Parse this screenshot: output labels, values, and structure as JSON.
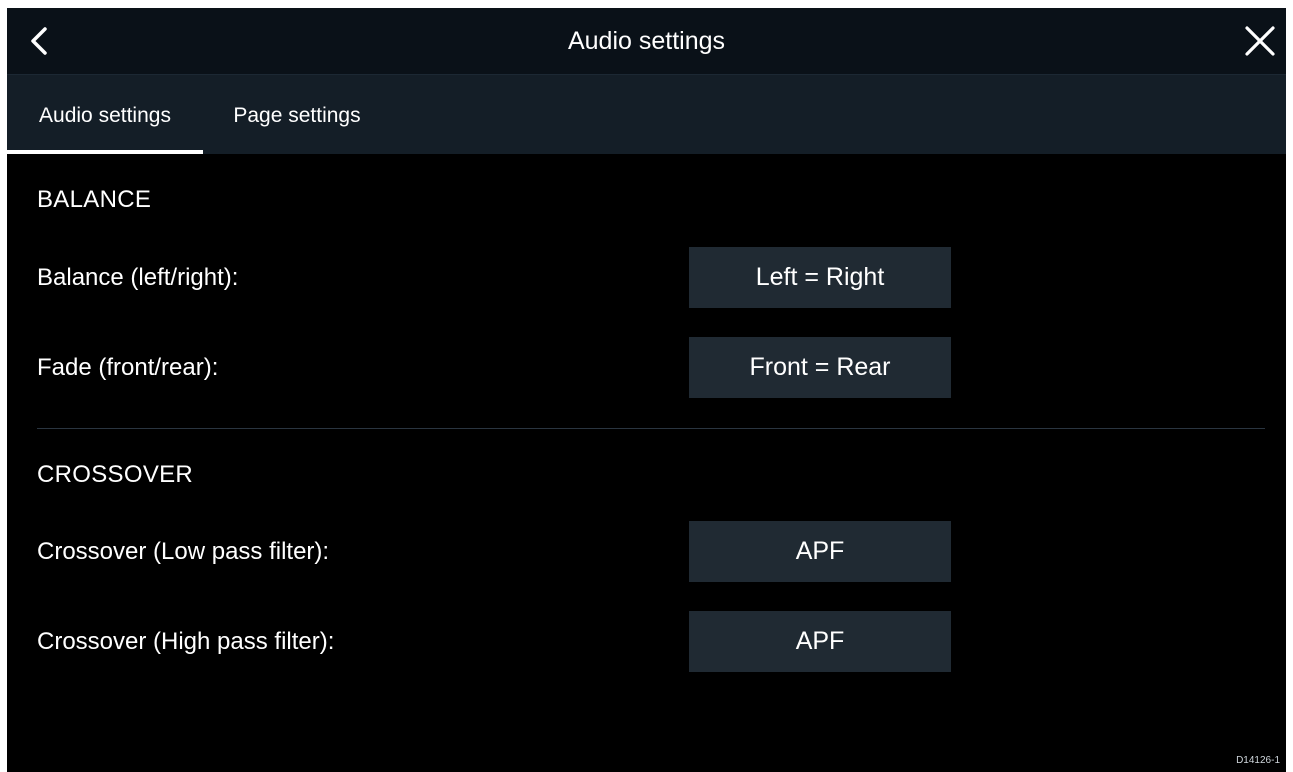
{
  "header": {
    "title": "Audio settings",
    "back_icon": "chevron-left-icon",
    "close_icon": "close-icon"
  },
  "tabs": [
    {
      "label": "Audio settings",
      "active": true
    },
    {
      "label": "Page settings",
      "active": false
    }
  ],
  "balance_section": {
    "heading": "BALANCE",
    "rows": [
      {
        "label": "Balance (left/right):",
        "value": "Left = Right"
      },
      {
        "label": "Fade (front/rear):",
        "value": "Front = Rear"
      }
    ]
  },
  "crossover_section": {
    "heading": "CROSSOVER",
    "rows": [
      {
        "label": "Crossover (Low pass filter):",
        "value": "APF"
      },
      {
        "label": "Crossover (High pass filter):",
        "value": "APF"
      }
    ]
  },
  "footer": {
    "code": "D14126-1"
  },
  "colors": {
    "background": "#000000",
    "titlebar": "#0a1118",
    "tabbar": "#141e27",
    "value_button": "#202a33",
    "text": "#ffffff"
  }
}
